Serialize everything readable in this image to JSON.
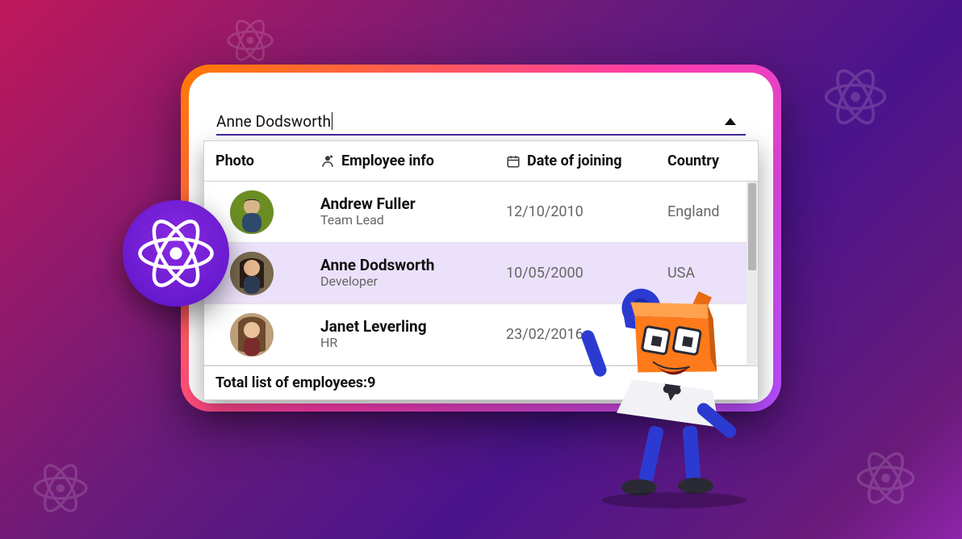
{
  "input": {
    "value": "Anne Dodsworth"
  },
  "columns": {
    "photo": "Photo",
    "employee_info": "Employee info",
    "date_of_joining": "Date of joining",
    "country": "Country"
  },
  "rows": [
    {
      "name": "Andrew Fuller",
      "role": "Team Lead",
      "date": "12/10/2010",
      "country": "England",
      "selected": false
    },
    {
      "name": "Anne Dodsworth",
      "role": "Developer",
      "date": "10/05/2000",
      "country": "USA",
      "selected": true
    },
    {
      "name": "Janet Leverling",
      "role": "HR",
      "date": "23/02/2016",
      "country": "",
      "selected": false
    }
  ],
  "footer": {
    "label": "Total list of employees:",
    "count": 9
  },
  "icons": {
    "person": "person-icon",
    "calendar": "calendar-icon",
    "chevron_up": "chevron-up-icon",
    "react_logo": "react-logo-icon"
  },
  "colors": {
    "accent": "#4527a0",
    "selection_bg": "#ece1fb"
  }
}
